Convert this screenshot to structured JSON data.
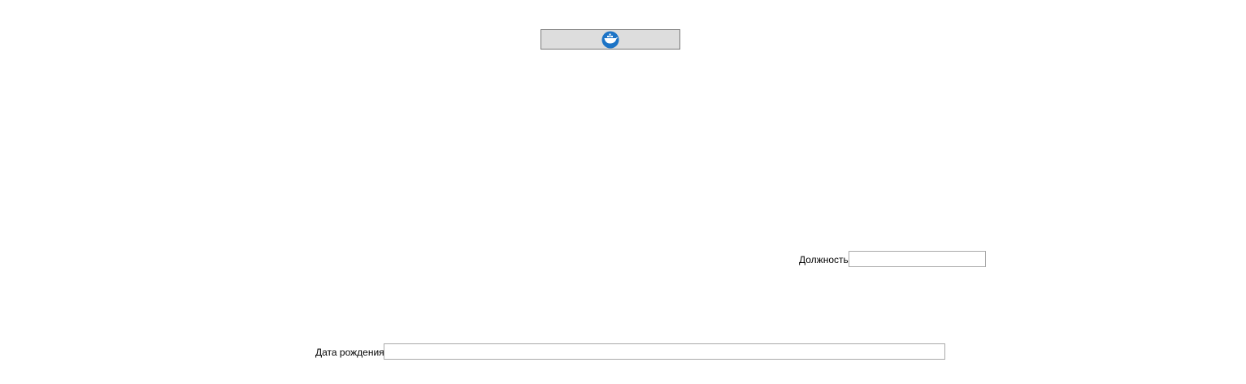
{
  "toolbar": {
    "docker_button": {
      "icon": "docker-whale-icon",
      "label": ""
    }
  },
  "form": {
    "position": {
      "label": "Должность",
      "value": "",
      "placeholder": ""
    },
    "birth_date": {
      "label": "Дата рождения",
      "value": "",
      "placeholder": ""
    }
  },
  "colors": {
    "background": "#ffffff",
    "button_fill": "#dddddd",
    "button_border": "#7a7a7a",
    "input_border": "#a9a9a9",
    "icon_blue": "#1d74c6"
  }
}
